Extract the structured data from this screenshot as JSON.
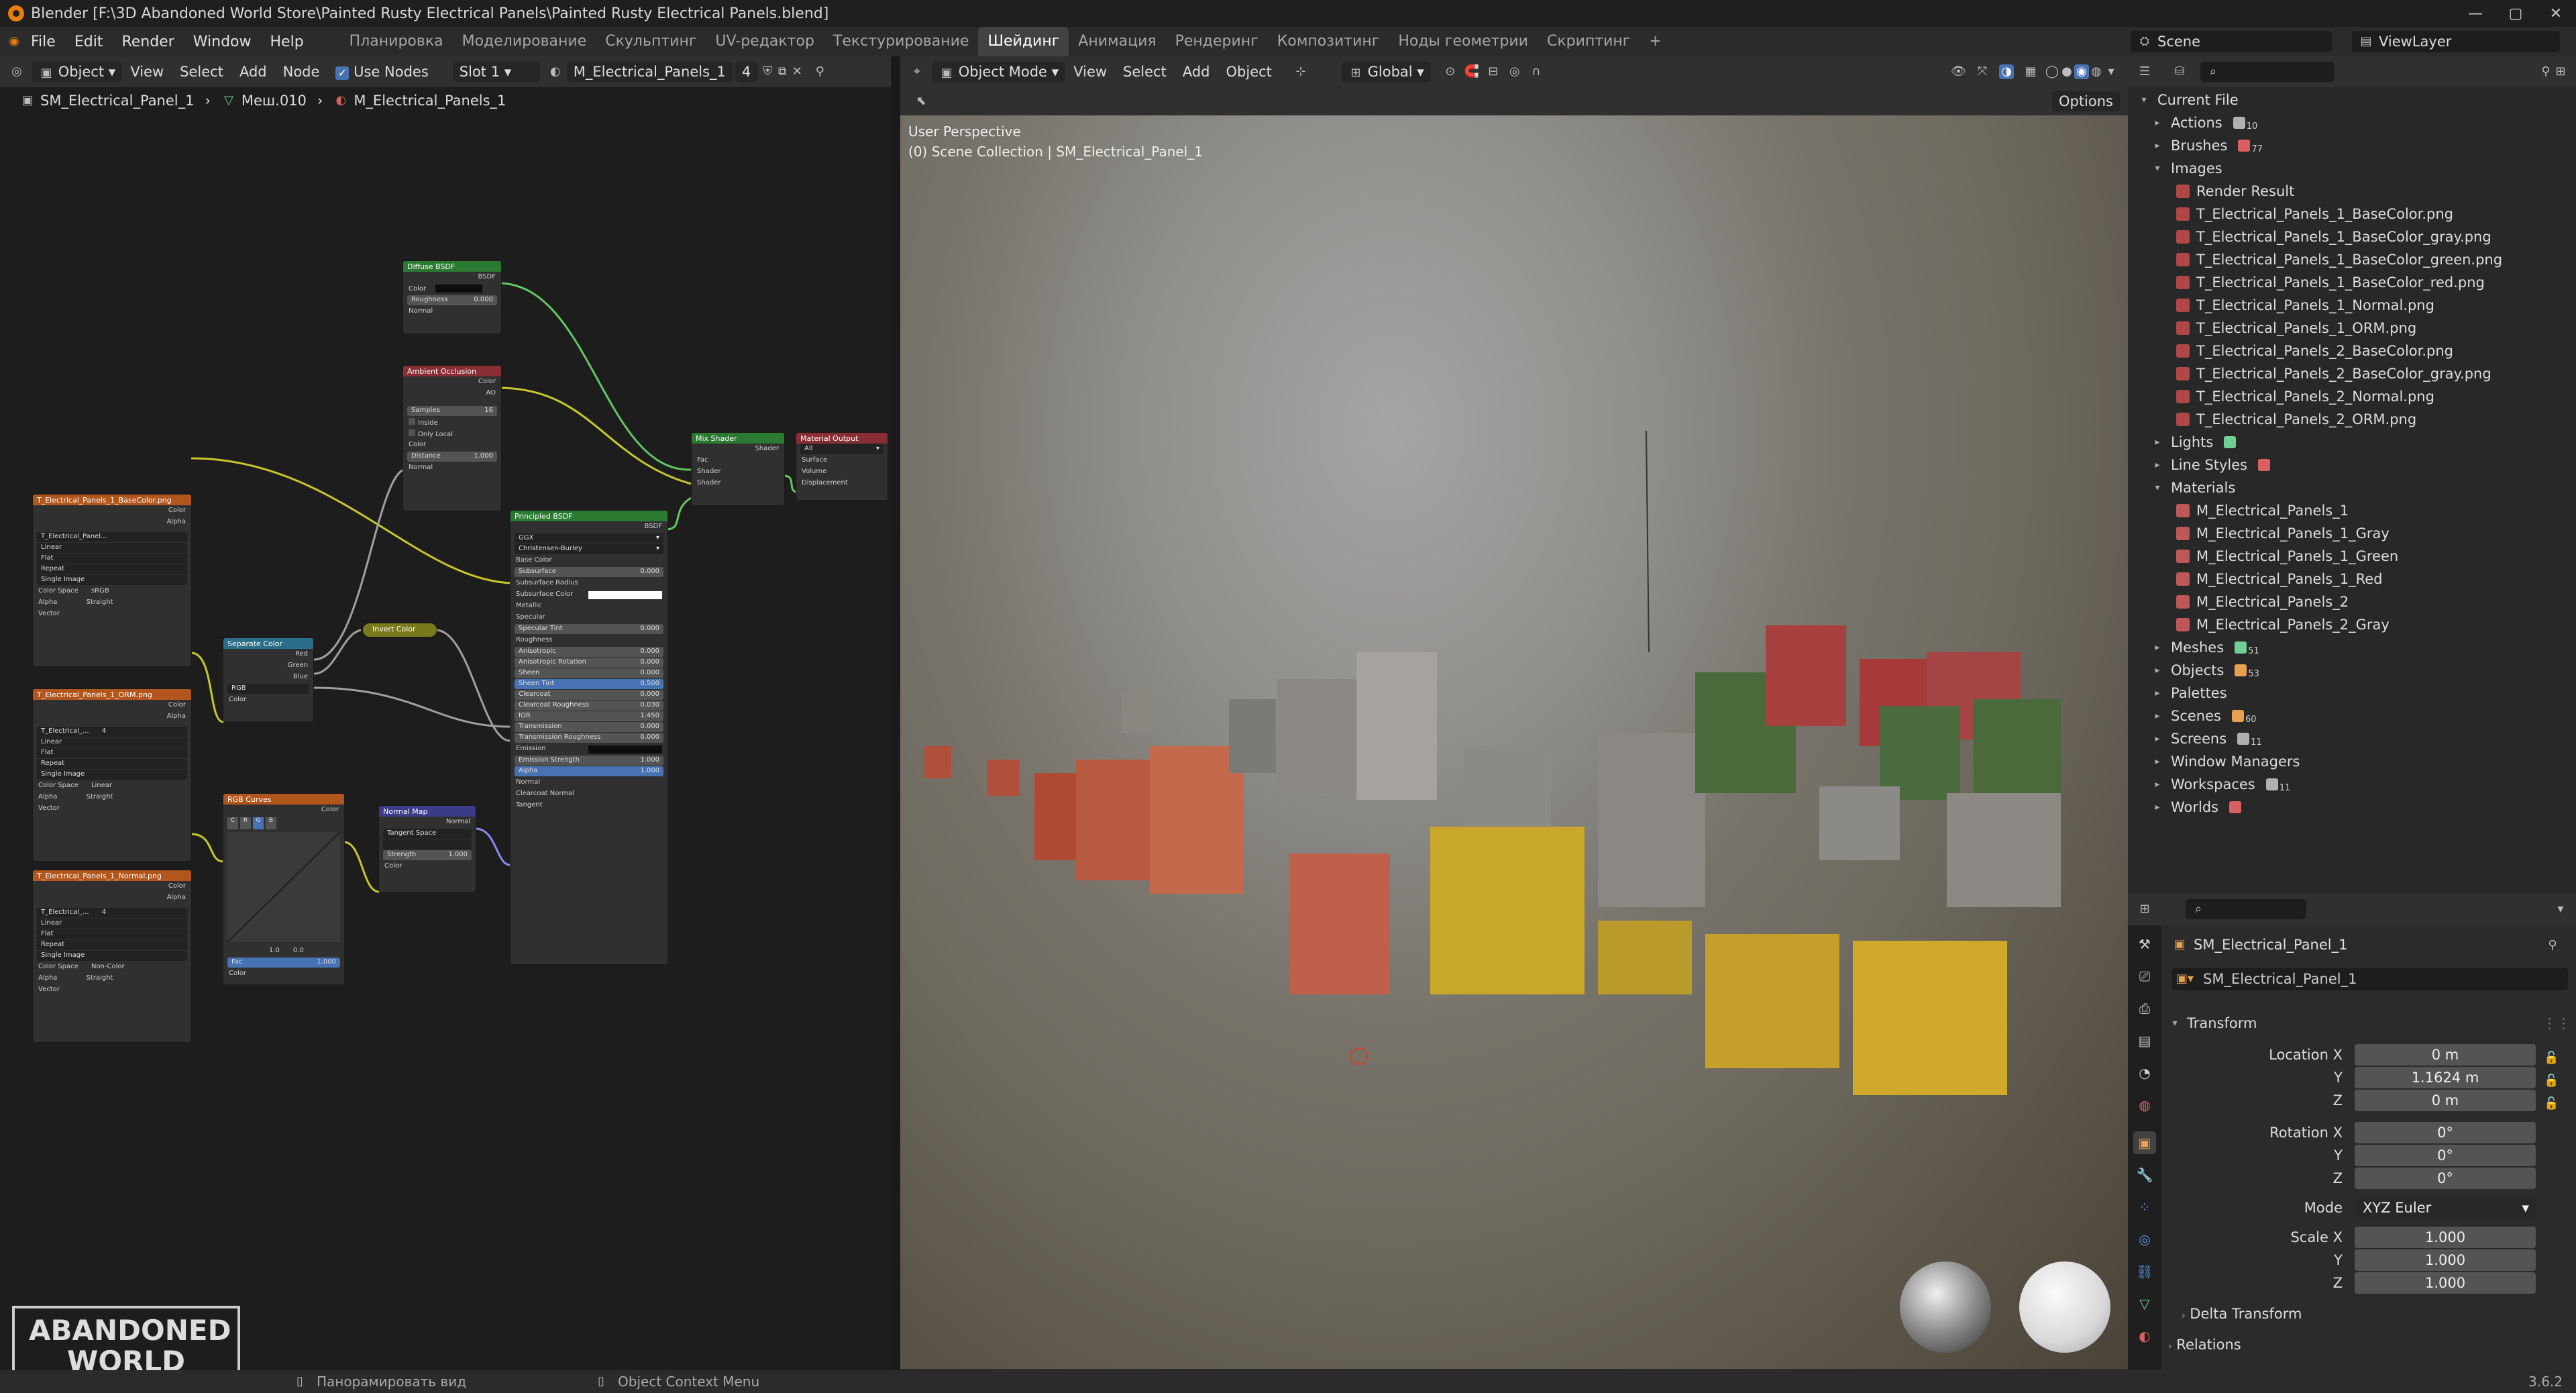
{
  "titlebar": {
    "title": "Blender [F:\\3D Abandoned World Store\\Painted Rusty Electrical Panels\\Painted Rusty Electrical Panels.blend]"
  },
  "menu": [
    "File",
    "Edit",
    "Render",
    "Window",
    "Help"
  ],
  "workspaces": [
    "Планировка",
    "Моделирование",
    "Скульптинг",
    "UV-редактор",
    "Текстурирование",
    "Шейдинг",
    "Анимация",
    "Рендеринг",
    "Композитинг",
    "Ноды геометрии",
    "Скриптинг"
  ],
  "active_workspace": "Шейдинг",
  "scene": "Scene",
  "view_layer": "ViewLayer",
  "node_header": {
    "object_mode": "Object",
    "items": [
      "View",
      "Select",
      "Add",
      "Node"
    ],
    "use_nodes": "Use Nodes",
    "slot": "Slot 1",
    "material": "M_Electrical_Panels_1",
    "users": "4"
  },
  "breadcrumb": [
    "SM_Electrical_Panel_1",
    "Меш.010",
    "M_Electrical_Panels_1"
  ],
  "nodes": {
    "diffuse": {
      "title": "Diffuse BSDF",
      "out": "BSDF",
      "color": "Color",
      "roughness": "Roughness",
      "roughness_val": "0.000",
      "normal": "Normal"
    },
    "ao": {
      "title": "Ambient Occlusion",
      "out_color": "Color",
      "out_ao": "AO",
      "samples": "Samples",
      "samples_val": "16",
      "inside": "Inside",
      "only_local": "Only Local",
      "color": "Color",
      "distance": "Distance",
      "distance_val": "1.000",
      "normal": "Normal"
    },
    "mix": {
      "title": "Mix Shader",
      "out": "Shader",
      "fac": "Fac",
      "sh1": "Shader",
      "sh2": "Shader"
    },
    "output": {
      "title": "Material Output",
      "target": "All",
      "surface": "Surface",
      "volume": "Volume",
      "displacement": "Displacement"
    },
    "principled": {
      "title": "Principled BSDF",
      "out": "BSDF",
      "dist": "GGX",
      "sss": "Christensen-Burley",
      "rows": [
        [
          "Base Color",
          ""
        ],
        [
          "Subsurface",
          "0.000"
        ],
        [
          "Subsurface Radius",
          ""
        ],
        [
          "Subsurface Color",
          ""
        ],
        [
          "Metallic",
          ""
        ],
        [
          "Specular",
          ""
        ],
        [
          "Specular Tint",
          "0.000"
        ],
        [
          "Roughness",
          ""
        ],
        [
          "Anisotropic",
          "0.000"
        ],
        [
          "Anisotropic Rotation",
          "0.000"
        ],
        [
          "Sheen",
          "0.000"
        ],
        [
          "Sheen Tint",
          "0.500"
        ],
        [
          "Clearcoat",
          "0.000"
        ],
        [
          "Clearcoat Roughness",
          "0.030"
        ],
        [
          "IOR",
          "1.450"
        ],
        [
          "Transmission",
          "0.000"
        ],
        [
          "Transmission Roughness",
          "0.000"
        ],
        [
          "Emission",
          ""
        ],
        [
          "Emission Strength",
          "1.000"
        ],
        [
          "Alpha",
          "1.000"
        ],
        [
          "Normal",
          ""
        ],
        [
          "Clearcoat Normal",
          ""
        ],
        [
          "Tangent",
          ""
        ]
      ]
    },
    "tex1": {
      "title": "T_Electrical_Panels_1_BaseColor.png",
      "img": "T_Electrical_Panel...",
      "interp": "Linear",
      "proj": "Flat",
      "ext": "Repeat",
      "src": "Single Image",
      "cs": "Color Space",
      "cs_val": "sRGB",
      "alpha": "Alpha",
      "alpha_val": "Straight",
      "vector": "Vector",
      "color": "Color",
      "alpha_out": "Alpha"
    },
    "tex2": {
      "title": "T_Electrical_Panels_1_ORM.png",
      "img": "T_Electrical_...",
      "users": "4",
      "interp": "Linear",
      "proj": "Flat",
      "ext": "Repeat",
      "src": "Single Image",
      "cs": "Color Space",
      "cs_val": "Linear",
      "alpha": "Alpha",
      "alpha_val": "Straight",
      "vector": "Vector",
      "color": "Color",
      "alpha_out": "Alpha"
    },
    "tex3": {
      "title": "T_Electrical_Panels_1_Normal.png",
      "img": "T_Electrical_...",
      "users": "4",
      "interp": "Linear",
      "proj": "Flat",
      "ext": "Repeat",
      "src": "Single Image",
      "cs": "Color Space",
      "cs_val": "Non-Color",
      "alpha": "Alpha",
      "alpha_val": "Straight",
      "vector": "Vector",
      "color": "Color",
      "alpha_out": "Alpha"
    },
    "sep": {
      "title": "Separate Color",
      "red": "Red",
      "green": "Green",
      "blue": "Blue",
      "mode": "RGB",
      "color": "Color"
    },
    "invert": {
      "title": "Invert Color"
    },
    "curves": {
      "title": "RGB Curves",
      "out": "Color",
      "fac": "Fac",
      "fac_val": "1.000",
      "color": "Color",
      "v1": "1.0",
      "v2": "0.0"
    },
    "normal": {
      "title": "Normal Map",
      "out": "Normal",
      "space": "Tangent Space",
      "strength": "Strength",
      "strength_val": "1.000",
      "color": "Color"
    }
  },
  "viewport_header": {
    "mode": "Object Mode",
    "items": [
      "View",
      "Select",
      "Add",
      "Object"
    ],
    "orientation": "Global",
    "options": "Options"
  },
  "viewport_overlay": {
    "perspective": "User Perspective",
    "collection": "(0) Scene Collection | SM_Electrical_Panel_1"
  },
  "watermark": "ABANDONED WORLD",
  "outliner": {
    "root": "Current File",
    "rows": [
      {
        "label": "Actions",
        "level": 1,
        "open": false,
        "count": "10",
        "color": "#b0b0b0"
      },
      {
        "label": "Brushes",
        "level": 1,
        "open": false,
        "count": "77",
        "color": "#d86060"
      },
      {
        "label": "Images",
        "level": 1,
        "open": true,
        "count": "",
        "color": ""
      },
      {
        "label": "Render Result",
        "level": 2,
        "color": "#c84c4c"
      },
      {
        "label": "T_Electrical_Panels_1_BaseColor.png",
        "level": 2,
        "color": "#c84c4c"
      },
      {
        "label": "T_Electrical_Panels_1_BaseColor_gray.png",
        "level": 2,
        "color": "#c84c4c"
      },
      {
        "label": "T_Electrical_Panels_1_BaseColor_green.png",
        "level": 2,
        "color": "#c84c4c"
      },
      {
        "label": "T_Electrical_Panels_1_BaseColor_red.png",
        "level": 2,
        "color": "#c84c4c"
      },
      {
        "label": "T_Electrical_Panels_1_Normal.png",
        "level": 2,
        "color": "#c84c4c"
      },
      {
        "label": "T_Electrical_Panels_1_ORM.png",
        "level": 2,
        "color": "#c84c4c"
      },
      {
        "label": "T_Electrical_Panels_2_BaseColor.png",
        "level": 2,
        "color": "#c84c4c"
      },
      {
        "label": "T_Electrical_Panels_2_BaseColor_gray.png",
        "level": 2,
        "color": "#c84c4c"
      },
      {
        "label": "T_Electrical_Panels_2_Normal.png",
        "level": 2,
        "color": "#c84c4c"
      },
      {
        "label": "T_Electrical_Panels_2_ORM.png",
        "level": 2,
        "color": "#c84c4c"
      },
      {
        "label": "Lights",
        "level": 1,
        "open": false,
        "count": "",
        "color": "#6fcf97"
      },
      {
        "label": "Line Styles",
        "level": 1,
        "open": false,
        "count": "",
        "color": "#d86060"
      },
      {
        "label": "Materials",
        "level": 1,
        "open": true,
        "count": "",
        "color": ""
      },
      {
        "label": "M_Electrical_Panels_1",
        "level": 2,
        "color": "#d86060"
      },
      {
        "label": "M_Electrical_Panels_1_Gray",
        "level": 2,
        "color": "#d86060"
      },
      {
        "label": "M_Electrical_Panels_1_Green",
        "level": 2,
        "color": "#d86060"
      },
      {
        "label": "M_Electrical_Panels_1_Red",
        "level": 2,
        "color": "#d86060"
      },
      {
        "label": "M_Electrical_Panels_2",
        "level": 2,
        "color": "#d86060"
      },
      {
        "label": "M_Electrical_Panels_2_Gray",
        "level": 2,
        "color": "#d86060"
      },
      {
        "label": "Meshes",
        "level": 1,
        "open": false,
        "count": "51",
        "color": "#6fcf97"
      },
      {
        "label": "Objects",
        "level": 1,
        "open": false,
        "count": "53",
        "color": "#e8a050"
      },
      {
        "label": "Palettes",
        "level": 1,
        "open": false,
        "count": "",
        "color": ""
      },
      {
        "label": "Scenes",
        "level": 1,
        "open": false,
        "count": "60",
        "color": "#e8a050"
      },
      {
        "label": "Screens",
        "level": 1,
        "open": false,
        "count": "11",
        "color": "#b0b0b0"
      },
      {
        "label": "Window Managers",
        "level": 1,
        "open": false,
        "count": "",
        "color": ""
      },
      {
        "label": "Workspaces",
        "level": 1,
        "open": false,
        "count": "11",
        "color": "#b0b0b0"
      },
      {
        "label": "Worlds",
        "level": 1,
        "open": false,
        "count": "",
        "color": "#d86060"
      }
    ]
  },
  "properties": {
    "object_name": "SM_Electrical_Panel_1",
    "datablock": "SM_Electrical_Panel_1",
    "transform": "Transform",
    "location_label": "Location X",
    "rotation_label": "Rotation X",
    "scale_label": "Scale X",
    "location": [
      "0 m",
      "1.1624 m",
      "0 m"
    ],
    "rotation": [
      "0°",
      "0°",
      "0°"
    ],
    "mode_label": "Mode",
    "mode": "XYZ Euler",
    "scale": [
      "1.000",
      "1.000",
      "1.000"
    ],
    "y": "Y",
    "z": "Z",
    "delta": "Delta Transform",
    "relations": "Relations"
  },
  "status": {
    "pan": "Панорамировать вид",
    "context": "Object Context Menu",
    "version": "3.6.2"
  },
  "colors": {
    "accent": "#4772b3",
    "shader_header": "#2a7a32",
    "texture_header": "#b1561c",
    "converter_header": "#2c6e8a",
    "vector_header": "#3b3b8a",
    "output_header": "#8a2e36"
  }
}
